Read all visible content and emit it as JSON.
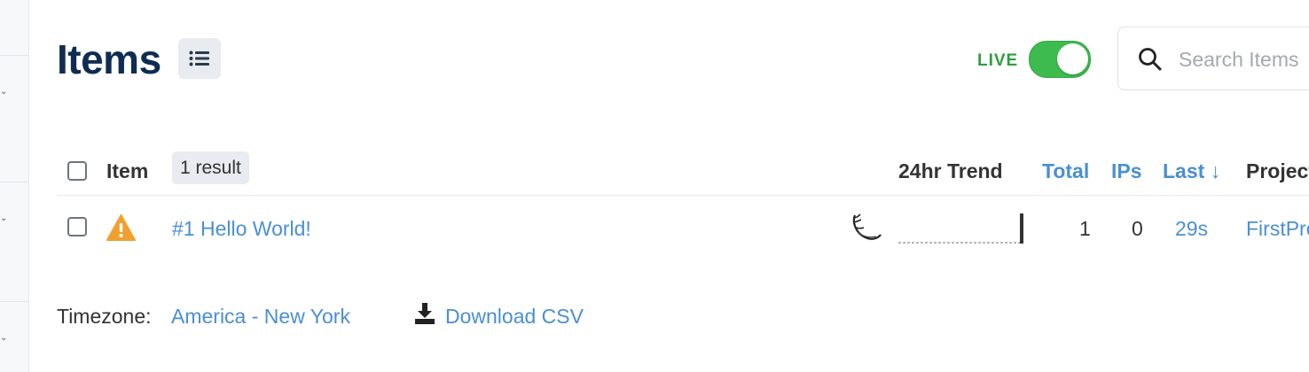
{
  "header": {
    "title": "Items",
    "live_label": "LIVE",
    "live_enabled": true
  },
  "search": {
    "placeholder": "Search Items"
  },
  "table": {
    "columns": {
      "item": "Item",
      "trend": "24hr Trend",
      "total": "Total",
      "ips": "IPs",
      "last": "Last",
      "last_sort_indicator": "↓",
      "project": "Project"
    },
    "result_count": "1 result",
    "rows": [
      {
        "level": "warning",
        "title": "#1 Hello World!",
        "framework_icon": "flask-icon",
        "total": "1",
        "ips": "0",
        "last": "29s",
        "project": "FirstProject"
      }
    ]
  },
  "footer": {
    "timezone_label": "Timezone:",
    "timezone_value": "America - New York",
    "download_label": "Download CSV"
  },
  "colors": {
    "title": "#0f2d52",
    "link": "#4a8fd4",
    "live": "#3dbb4f",
    "warning": "#f0a030"
  }
}
